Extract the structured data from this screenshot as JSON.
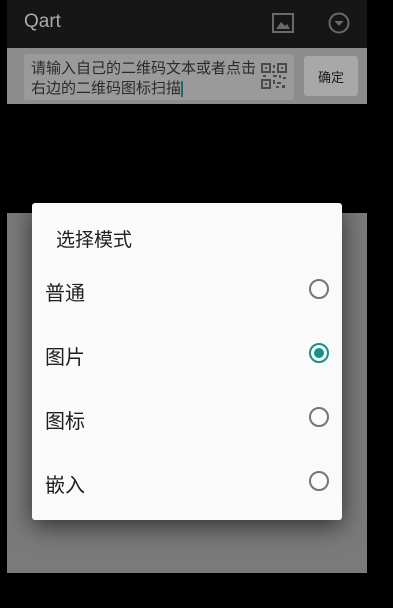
{
  "app": {
    "title": "Qart",
    "toolbar_icons": [
      "image-icon",
      "dropdown-menu-icon"
    ]
  },
  "input": {
    "value": "请输入自己的二维码文本或者点击右边的二维码图标扫描",
    "scan_icon": "qr-code-icon",
    "confirm_label": "确定"
  },
  "dialog": {
    "title": "选择模式",
    "options": [
      {
        "label": "普通",
        "selected": false
      },
      {
        "label": "图片",
        "selected": true
      },
      {
        "label": "图标",
        "selected": false
      },
      {
        "label": "嵌入",
        "selected": false
      }
    ]
  },
  "colors": {
    "accent": "#149384",
    "radio_off": "#757575",
    "dialog_bg": "#fafafa"
  }
}
